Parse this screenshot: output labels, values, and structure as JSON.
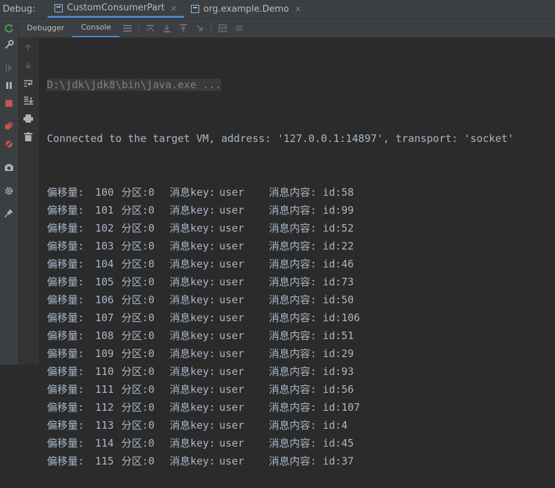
{
  "titlebar": {
    "debug_label": "Debug:",
    "tabs": [
      {
        "label": "CustomConsumerPart",
        "active": true
      },
      {
        "label": "org.example.Demo",
        "active": false
      }
    ],
    "close_glyph": "×"
  },
  "toolbar": {
    "tabs": [
      {
        "label": "Debugger",
        "active": false
      },
      {
        "label": "Console",
        "active": true
      }
    ]
  },
  "console": {
    "command": "D:\\jdk\\jdk8\\bin\\java.exe ...",
    "connected": "Connected to the target VM, address: '127.0.0.1:14897', transport: 'socket'",
    "labels": {
      "offset": "偏移量:",
      "partition": "分区:",
      "key": "消息key:",
      "content": "消息内容:"
    },
    "messages": [
      {
        "offset": "100",
        "partition": "0",
        "key": "user",
        "content": "id:58"
      },
      {
        "offset": "101",
        "partition": "0",
        "key": "user",
        "content": "id:99"
      },
      {
        "offset": "102",
        "partition": "0",
        "key": "user",
        "content": "id:52"
      },
      {
        "offset": "103",
        "partition": "0",
        "key": "user",
        "content": "id:22"
      },
      {
        "offset": "104",
        "partition": "0",
        "key": "user",
        "content": "id:46"
      },
      {
        "offset": "105",
        "partition": "0",
        "key": "user",
        "content": "id:73"
      },
      {
        "offset": "106",
        "partition": "0",
        "key": "user",
        "content": "id:50"
      },
      {
        "offset": "107",
        "partition": "0",
        "key": "user",
        "content": "id:106"
      },
      {
        "offset": "108",
        "partition": "0",
        "key": "user",
        "content": "id:51"
      },
      {
        "offset": "109",
        "partition": "0",
        "key": "user",
        "content": "id:29"
      },
      {
        "offset": "110",
        "partition": "0",
        "key": "user",
        "content": "id:93"
      },
      {
        "offset": "111",
        "partition": "0",
        "key": "user",
        "content": "id:56"
      },
      {
        "offset": "112",
        "partition": "0",
        "key": "user",
        "content": "id:107"
      },
      {
        "offset": "113",
        "partition": "0",
        "key": "user",
        "content": "id:4"
      },
      {
        "offset": "114",
        "partition": "0",
        "key": "user",
        "content": "id:45"
      },
      {
        "offset": "115",
        "partition": "0",
        "key": "user",
        "content": "id:37"
      }
    ]
  },
  "icons": {
    "left": [
      "rerun-icon",
      "settings-wrench-icon",
      "resume-icon",
      "pause-icon",
      "stop-icon",
      "view-breakpoints-icon",
      "mute-breakpoints-icon",
      "camera-icon",
      "gear-icon",
      "pin-icon"
    ],
    "gutter": [
      "up-arrow-icon",
      "down-arrow-icon",
      "soft-wrap-icon",
      "scroll-to-end-icon",
      "print-icon",
      "trash-icon"
    ]
  },
  "colors": {
    "background": "#2b2b2b",
    "text": "#a9b7c6",
    "accent": "#4a88c7",
    "rerun": "#499c54",
    "stop": "#c75450"
  }
}
